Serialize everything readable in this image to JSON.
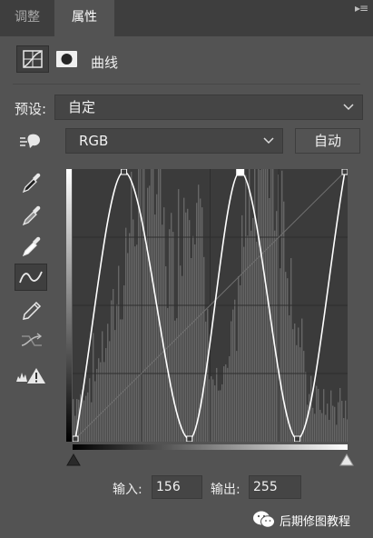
{
  "tabs": [
    {
      "label": "调整",
      "active": false
    },
    {
      "label": "属性",
      "active": true
    }
  ],
  "panel": {
    "title": "曲线",
    "preset_label": "预设:",
    "preset_value": "自定",
    "channel_value": "RGB",
    "auto_button": "自动"
  },
  "tools": [
    {
      "icon": "on-image-adjust-icon"
    },
    {
      "icon": "eyedropper-black-icon"
    },
    {
      "icon": "eyedropper-gray-icon"
    },
    {
      "icon": "eyedropper-white-icon"
    },
    {
      "icon": "curve-points-icon",
      "selected": true
    },
    {
      "icon": "pencil-icon"
    },
    {
      "icon": "smooth-curve-icon"
    },
    {
      "icon": "clipping-warning-icon"
    }
  ],
  "io": {
    "input_label": "输入:",
    "input_value": "156",
    "output_label": "输出:",
    "output_value": "255"
  },
  "watermark": {
    "text": "后期修图教程",
    "icon": "wechat-icon"
  },
  "chart_data": {
    "type": "line",
    "x": [
      0,
      46,
      108,
      156,
      210,
      255
    ],
    "y": [
      0,
      255,
      0,
      255,
      0,
      255
    ],
    "xlim": [
      0,
      255
    ],
    "ylim": [
      0,
      255
    ],
    "grid": true,
    "selected_point": {
      "x": 156,
      "y": 255
    },
    "colors": {
      "curve": "#ffffff",
      "grid": "#2d2d2d",
      "baseline": "#6f6f6f",
      "histogram": "#8a8a8a"
    }
  }
}
